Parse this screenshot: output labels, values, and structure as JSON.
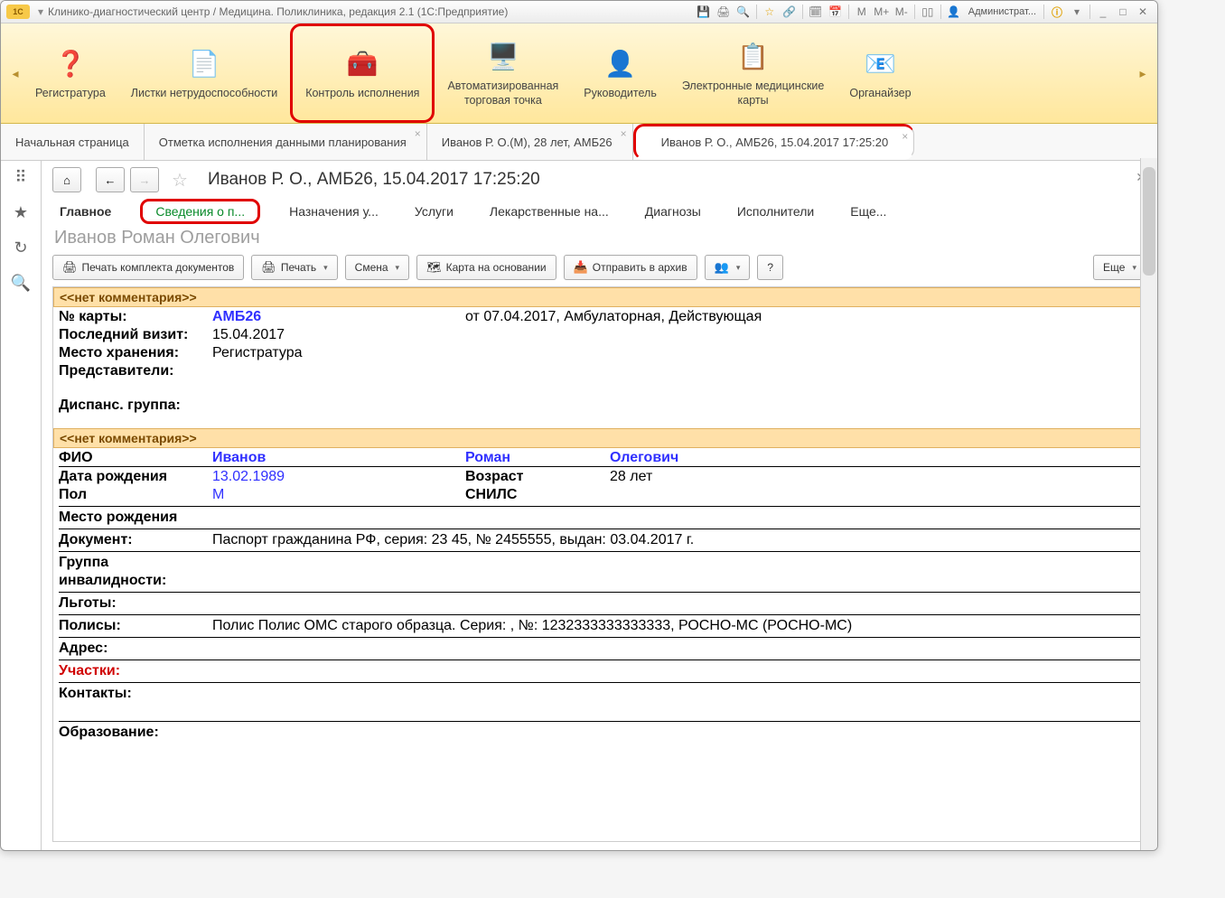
{
  "titlebar": {
    "app_badge": "1С",
    "title": "Клинико-диагностический центр / Медицина. Поликлиника, редакция 2.1  (1С:Предприятие)",
    "user": "Администрат...",
    "icons": {
      "save": "💾",
      "print": "🖨",
      "preview": "🔍",
      "star": "☆",
      "link": "🔗",
      "calc": "🗓",
      "cal": "📅",
      "m": "M",
      "mp": "M+",
      "mm": "M-",
      "panel": "▯▯",
      "info": "ⓘ",
      "min": "_",
      "max": "□",
      "close": "✕",
      "user_ico": "👤",
      "caret": "▾"
    }
  },
  "sections": {
    "items": [
      {
        "icon": "❓",
        "label": "Регистратура"
      },
      {
        "icon": "📄",
        "label": "Листки нетрудоспособности"
      },
      {
        "icon": "🧰",
        "label": "Контроль исполнения",
        "hl": true
      },
      {
        "icon": "🖥️",
        "label": "Автоматизированная",
        "label2": "торговая точка"
      },
      {
        "icon": "👤",
        "label": "Руководитель"
      },
      {
        "icon": "📋",
        "label": "Электронные медицинские",
        "label2": "карты"
      },
      {
        "icon": "📧",
        "label": "Органайзер"
      }
    ],
    "prev": "◂",
    "next": "▸"
  },
  "tabs": [
    {
      "label": "Начальная страница"
    },
    {
      "label": "Отметка исполнения данными планирования",
      "closable": true
    },
    {
      "label": "Иванов Р. О.(М), 28 лет, АМБ26",
      "closable": true
    },
    {
      "label": "Иванов Р. О., АМБ26, 15.04.2017 17:25:20",
      "closable": true,
      "hl": true,
      "active": true
    }
  ],
  "leftrail": {
    "apps": "⠿",
    "star": "★",
    "history": "↻",
    "search": "🔍"
  },
  "page": {
    "home": "⌂",
    "back": "←",
    "fwd": "→",
    "star": "☆",
    "close": "✕",
    "title": "Иванов Р. О., АМБ26, 15.04.2017 17:25:20",
    "subtabs": [
      "Главное",
      "Сведения о п...",
      "Назначения у...",
      "Услуги",
      "Лекарственные на...",
      "Диагнозы",
      "Исполнители",
      "Еще..."
    ],
    "patient": "Иванов Роман Олегович"
  },
  "toolbar": {
    "print_set": "Печать комплекта документов",
    "print": "Печать",
    "shift": "Смена",
    "map": "Карта на основании",
    "archive": "Отправить в архив",
    "help": "?",
    "more": "Еще",
    "ico": {
      "print": "🖨",
      "map": "🗺",
      "archive": "📥",
      "users": "👥",
      "caret": "▾"
    }
  },
  "card": {
    "no_comment": "<<нет комментария>>",
    "card_no_lbl": "№ карты:",
    "card_no": "АМБ26",
    "card_from": "от 07.04.2017, Амбулаторная, Действующая",
    "last_visit_lbl": "Последний визит:",
    "last_visit": "15.04.2017",
    "storage_lbl": "Место хранения:",
    "storage": "Регистратура",
    "reps_lbl": "Представители:",
    "disp_lbl": "Диспанс. группа:",
    "fio_lbl": "ФИО",
    "last": "Иванов",
    "first": "Роман",
    "middle": "Олегович",
    "dob_lbl": "Дата рождения",
    "dob": "13.02.1989",
    "age_lbl": "Возраст",
    "age": "28 лет",
    "sex_lbl": "Пол",
    "sex": "М",
    "snils_lbl": "СНИЛС",
    "birthplace_lbl": "Место рождения",
    "doc_lbl": "Документ:",
    "doc": "Паспорт гражданина РФ, серия: 23 45, № 2455555, выдан: 03.04.2017 г.",
    "disab_lbl": "Группа",
    "disab_lbl2": "инвалидности:",
    "lgoty_lbl": "Льготы:",
    "polis_lbl": "Полисы:",
    "polis": "Полис Полис ОМС старого образца. Серия: , №: 1232333333333333, РОСНО-МС (РОСНО-МС)",
    "addr_lbl": "Адрес:",
    "uch_lbl": "Участки:",
    "contacts_lbl": "Контакты:",
    "edu_lbl": "Образование:"
  }
}
